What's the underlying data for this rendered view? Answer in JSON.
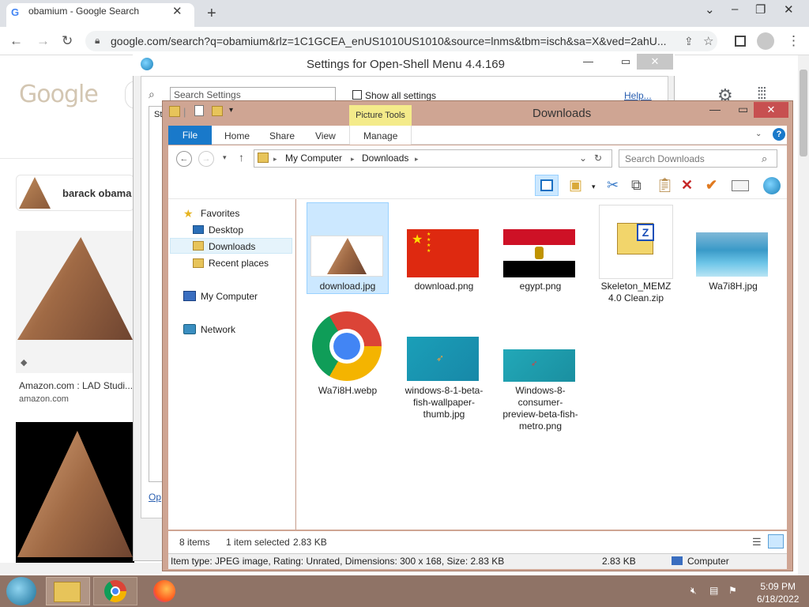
{
  "browser": {
    "tab_title": "obamium - Google Search",
    "tab_favicon": "G",
    "url": "google.com/search?q=obamium&rlz=1C1GCEA_enUS1010US1010&source=lnms&tbm=isch&sa=X&ved=2ahU..."
  },
  "google": {
    "logo_text": "Google",
    "suggestion": "barack obama",
    "result1_source": "Amazon.com : LAD Studi...",
    "result1_domain": "amazon.com"
  },
  "openshell": {
    "title": "Settings for Open-Shell Menu 4.4.169",
    "search_placeholder": "Search Settings",
    "show_all_label": "Show all settings",
    "help_label": "Help...",
    "st_fragment": "St",
    "op_fragment": "Op"
  },
  "explorer": {
    "title": "Downloads",
    "picture_tools": "Picture Tools",
    "tabs": {
      "file": "File",
      "home": "Home",
      "share": "Share",
      "view": "View",
      "manage": "Manage"
    },
    "address": {
      "root": "My Computer",
      "folder": "Downloads"
    },
    "search_placeholder": "Search Downloads",
    "nav": {
      "favorites": "Favorites",
      "desktop": "Desktop",
      "downloads": "Downloads",
      "recent": "Recent places",
      "computer": "My Computer",
      "network": "Network"
    },
    "files": [
      {
        "name": "download.jpg"
      },
      {
        "name": "download.png"
      },
      {
        "name": "egypt.png"
      },
      {
        "name": "Skeleton_MEMZ 4.0 Clean.zip"
      },
      {
        "name": "Wa7i8H.jpg"
      },
      {
        "name": "Wa7i8H.webp"
      },
      {
        "name": "windows-8-1-beta-fish-wallpaper-thumb.jpg"
      },
      {
        "name": "Windows-8-consumer-preview-beta-fish-metro.png"
      }
    ],
    "status": {
      "count": "8 items",
      "selected": "1 item selected",
      "size": "2.83 KB"
    },
    "details": {
      "info": "Item type: JPEG image, Rating: Unrated, Dimensions: 300 x 168, Size: 2.83 KB",
      "size": "2.83 KB",
      "location": "Computer"
    }
  },
  "taskbar": {
    "time": "5:09 PM",
    "date": "6/18/2022"
  },
  "colors": {
    "explorer_frame": "#cfa593",
    "taskbar": "#8f7366",
    "file_tab": "#1979ca",
    "picture_tools": "#f4eb8a"
  }
}
